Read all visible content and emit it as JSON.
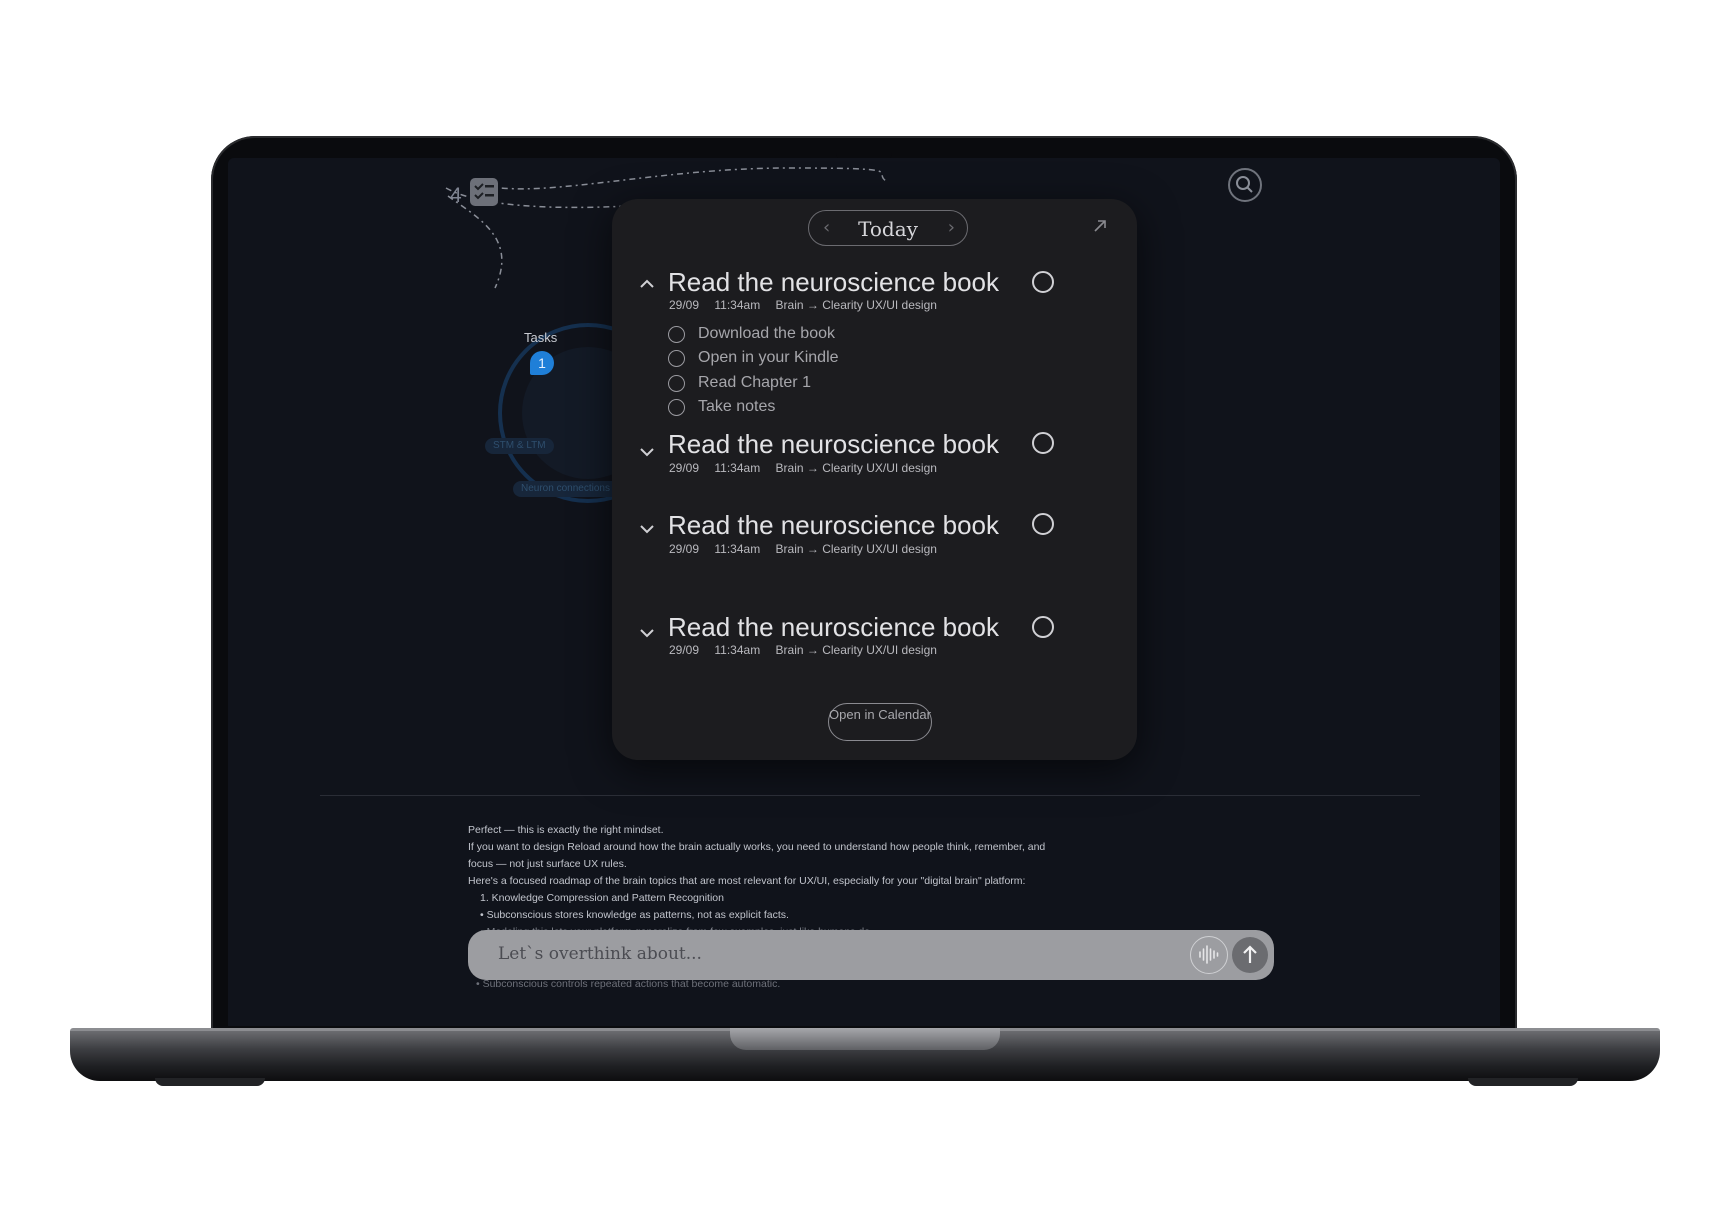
{
  "header": {
    "task_count": "4",
    "tasks_label": "Tasks",
    "tasks_badge": "1"
  },
  "mindmap": {
    "pills": [
      "STM & LTM",
      "Neuron connections"
    ]
  },
  "panel": {
    "date_label": "Today",
    "tasks": [
      {
        "title": "Read the neuroscience book",
        "date": "29/09",
        "time": "11:34am",
        "path": "Brain → Clearity UX/UI design",
        "expanded": true,
        "subtasks": [
          "Download the book",
          "Open in your Kindle",
          "Read Chapter 1",
          "Take notes"
        ]
      },
      {
        "title": "Read the neuroscience book",
        "date": "29/09",
        "time": "11:34am",
        "path": "Brain → Clearity UX/UI design",
        "expanded": false
      },
      {
        "title": "Read the neuroscience book",
        "date": "29/09",
        "time": "11:34am",
        "path": "Brain → Clearity UX/UI design",
        "expanded": false
      },
      {
        "title": "Read the neuroscience book",
        "date": "29/09",
        "time": "11:34am",
        "path": "Brain → Clearity UX/UI design",
        "expanded": false
      }
    ],
    "open_calendar_label": "Open in Calendar"
  },
  "chat": {
    "lines": [
      "Perfect — this is exactly the right mindset.",
      "If you want to design Reload around how the brain actually works, you need to understand how people think, remember, and",
      "focus — not just surface UX rules.",
      "Here's a focused roadmap of the brain topics that are most relevant for UX/UI, especially for your \"digital brain\" platform:",
      "1.  Knowledge Compression and Pattern Recognition",
      "•  Subconscious stores knowledge as patterns, not as explicit facts.",
      "•  Modeling this lets your platform generalize from few examples, just like humans do."
    ],
    "hidden_line": "•  Subconscious controls repeated actions that become automatic."
  },
  "input": {
    "placeholder": "Let`s overthink about..."
  },
  "colors": {
    "screen_bg": "#10131b",
    "panel_bg": "#1c1c1f",
    "accent_blue": "#1f7fd8",
    "input_bg": "#9c9da1"
  },
  "icons": [
    "check-list-icon",
    "search-icon",
    "chevron-left-icon",
    "chevron-right-icon",
    "expand-arrow-icon",
    "chevron-up-icon",
    "chevron-down-icon",
    "voice-wave-icon",
    "arrow-up-icon"
  ]
}
